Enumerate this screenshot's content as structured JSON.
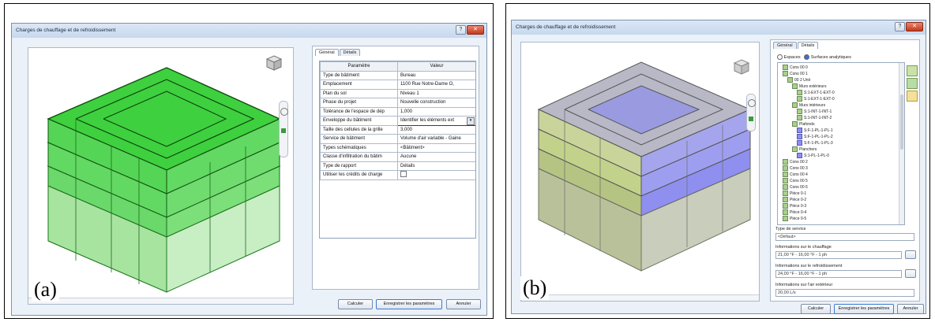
{
  "panel_a": {
    "label": "(a)",
    "window_title": "Charges de chauffage et de refroidissement",
    "tabs": [
      "Général",
      "Détails"
    ],
    "table_header": {
      "param": "Paramètre",
      "value": "Valeur"
    },
    "rows": [
      {
        "param": "Type de bâtiment",
        "value": "Bureau"
      },
      {
        "param": "Emplacement",
        "value": "1100 Rue Notre-Dame O,"
      },
      {
        "param": "Plan du sol",
        "value": "Niveau 1"
      },
      {
        "param": "Phase du projet",
        "value": "Nouvelle construction"
      },
      {
        "param": "Tolérance de l'espace de dép",
        "value": "1,000"
      },
      {
        "param": "Enveloppe du bâtiment",
        "value": "Identifier les éléments ext"
      },
      {
        "param": "Taille des cellules de la grille",
        "value": "3,000"
      },
      {
        "param": "Service de bâtiment",
        "value": "Volume d'air variable - Gaine"
      },
      {
        "param": "Types schématiques",
        "value": "<Bâtiment>"
      },
      {
        "param": "Classe d'infiltration du bâtim",
        "value": "Aucune"
      },
      {
        "param": "Type de rapport",
        "value": "Détails"
      },
      {
        "param": "Utiliser les crédits de charge",
        "value": ""
      }
    ],
    "buttons": {
      "calc": "Calculer",
      "save": "Enregistrer les paramètres",
      "cancel": "Annuler"
    }
  },
  "panel_b": {
    "label": "(b)",
    "window_title": "Charges de chauffage et de refroidissement",
    "tabs": [
      "Général",
      "Détails"
    ],
    "radio_spaces": "Espaces",
    "radio_surfaces": "Surfaces analytiques",
    "tree": [
      "Cons 00 0",
      "Cons 00 1",
      "00 2 Unit",
      "Murs extérieurs",
      "S:1-EXT-1-EXT-0",
      "S:1-EXT-1-EXT-0",
      "Murs intérieurs",
      "S:1-INT-1-INT-1",
      "S:1-INT-1-INT-2",
      "Plafonds",
      "S:F-1-PL-1-PL-1",
      "S:F-1-PL-1-PL-2",
      "S:F-1-PL-1-PL-3",
      "Planchers",
      "S:1-PL-1-PL-0",
      "Cons 00 2",
      "Cons 00 3",
      "Cons 00 4",
      "Cons 00 5",
      "Cons 00 6",
      "Pièce 0-1",
      "Pièce 0-2",
      "Pièce 0-3",
      "Pièce 0-4",
      "Pièce 0-5"
    ],
    "service_label": "Type de service",
    "service_value": "<Défaut>",
    "heating_label": "Informations sur le chauffage",
    "heating_value": "21,00 °F - 16,00 °F - 1 ph",
    "cooling_label": "Informations sur le refroidissement",
    "cooling_value": "24,00 °F - 16,00 °F - 1 ph",
    "airflow_label": "Informations sur l'air extérieur",
    "airflow_value": "20,00 L/s",
    "buttons": {
      "calc": "Calculer",
      "save": "Enregistrer les paramètres",
      "cancel": "Annuler"
    }
  },
  "colors": {
    "green_fill": "#5ce05c",
    "green_stroke": "#1e7a1e",
    "blue_fill": "#8f8ff0",
    "gray_fill": "#c9cdbb"
  }
}
